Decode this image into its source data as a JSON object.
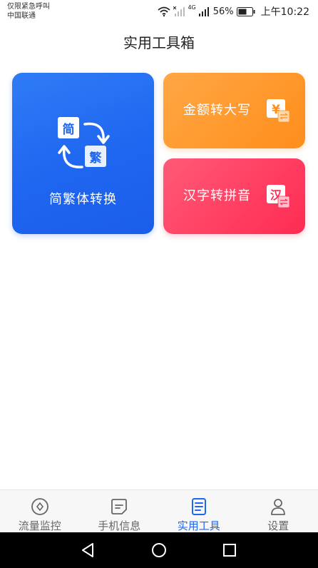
{
  "status_bar": {
    "line1": "仅限紧急呼叫",
    "line2": "中国联通",
    "network_label": "4G",
    "battery_percent": "56%",
    "time": "上午10:22"
  },
  "page": {
    "title": "实用工具箱"
  },
  "tools": {
    "simp_trad": {
      "label": "简繁体转换",
      "chip_simplified": "简",
      "chip_traditional": "繁",
      "color": "#1f66f0"
    },
    "amount_upper": {
      "label": "金额转大写",
      "icon_glyph": "¥",
      "color": "#ff8e1c"
    },
    "hanzi_pinyin": {
      "label": "汉字转拼音",
      "icon_glyph": "汉",
      "color": "#ff2b52"
    }
  },
  "bottom_nav": {
    "items": [
      {
        "label": "流量监控",
        "icon": "traffic-monitor-icon"
      },
      {
        "label": "手机信息",
        "icon": "phone-info-icon"
      },
      {
        "label": "实用工具",
        "icon": "tools-icon",
        "active": true
      },
      {
        "label": "设置",
        "icon": "user-settings-icon"
      }
    ],
    "active_color": "#1f66f0"
  }
}
